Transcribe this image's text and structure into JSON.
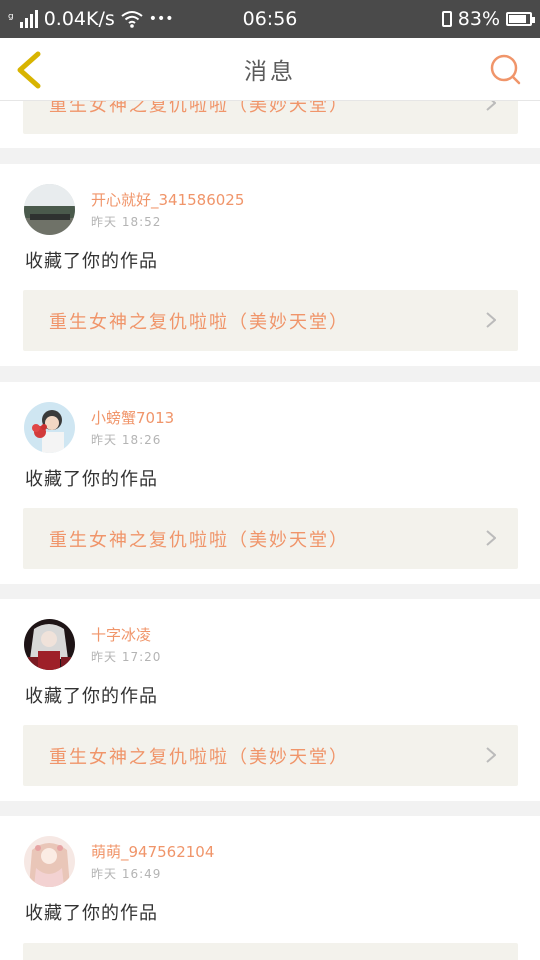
{
  "status": {
    "speed": "0.04K/s",
    "dots": "•••",
    "time": "06:56",
    "battery": "83%"
  },
  "header": {
    "title": "消息"
  },
  "colors": {
    "accent": "#f0956a",
    "card_bg": "#f3f2ec",
    "page_bg": "#f2f2f2"
  },
  "items": [
    {
      "work_title": "重生女神之复仇啦啦（美妙天堂）"
    },
    {
      "username": "开心就好_341586025",
      "time": "昨天 18:52",
      "action": "收藏了你的作品",
      "work_title": "重生女神之复仇啦啦（美妙天堂）"
    },
    {
      "username": "小螃蟹7013",
      "time": "昨天 18:26",
      "action": "收藏了你的作品",
      "work_title": "重生女神之复仇啦啦（美妙天堂）"
    },
    {
      "username": "十字冰凌",
      "time": "昨天 17:20",
      "action": "收藏了你的作品",
      "work_title": "重生女神之复仇啦啦（美妙天堂）"
    },
    {
      "username": "萌萌_947562104",
      "time": "昨天 16:49",
      "action": "收藏了你的作品"
    }
  ]
}
